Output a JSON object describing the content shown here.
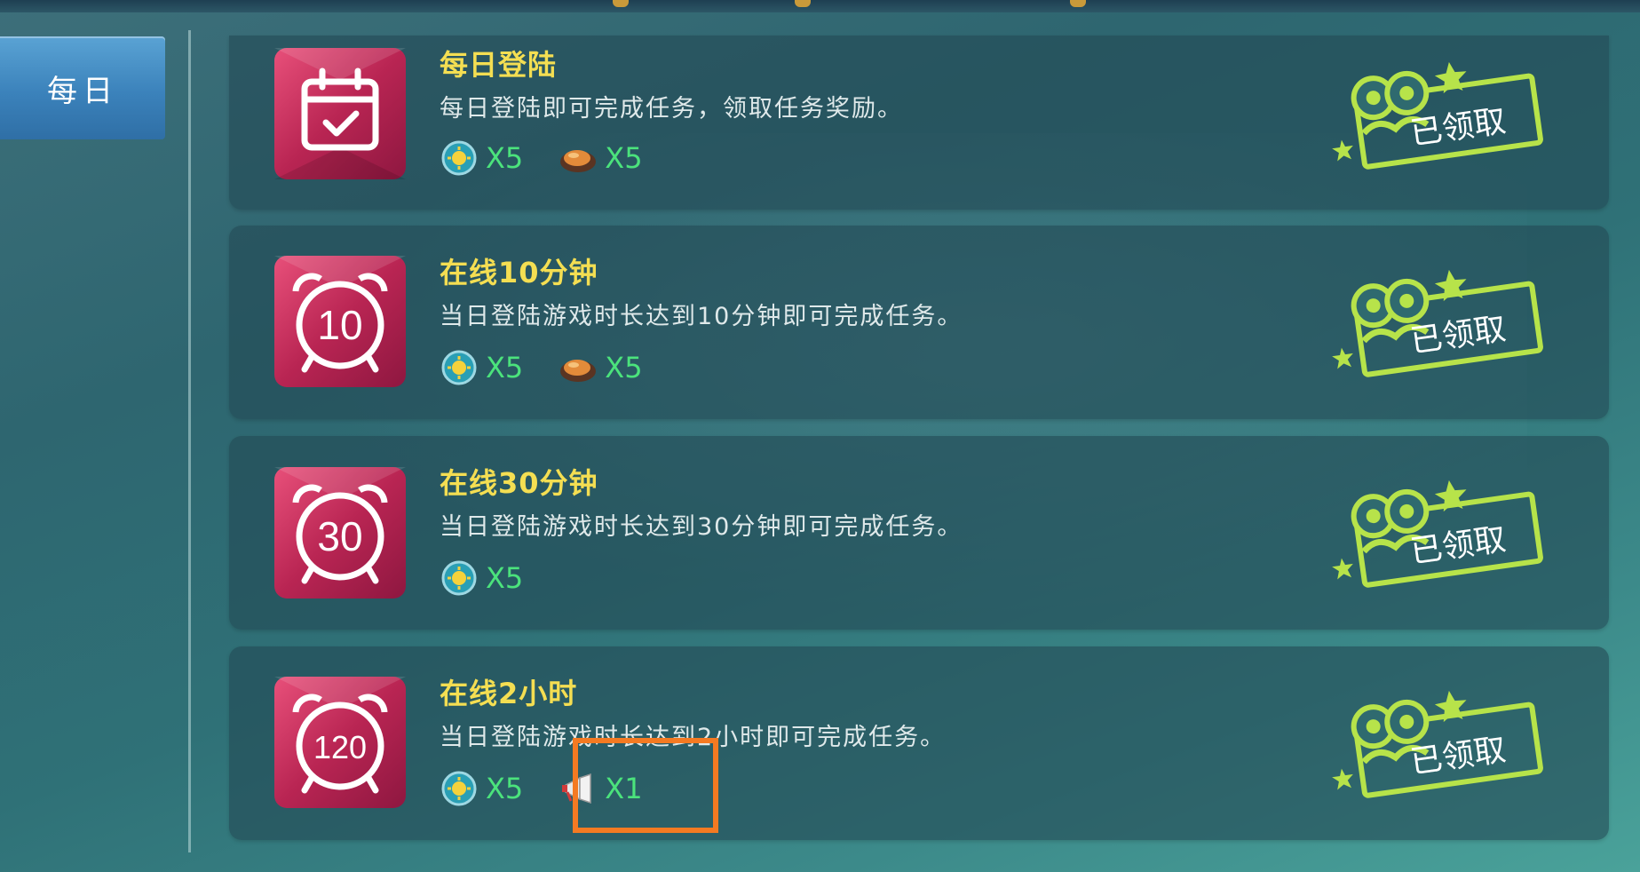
{
  "sidebar": {
    "tab_label": "每日"
  },
  "stamp_text": "已领取",
  "tasks": [
    {
      "icon": "calendar-check-icon",
      "title": "每日登陆",
      "desc": "每日登陆即可完成任务，领取任务奖励。",
      "rewards": [
        {
          "icon": "gear-coin-icon",
          "qty": "X5"
        },
        {
          "icon": "roast-food-icon",
          "qty": "X5"
        }
      ]
    },
    {
      "icon": "alarm-clock-icon",
      "icon_number": "10",
      "title": "在线10分钟",
      "desc": "当日登陆游戏时长达到10分钟即可完成任务。",
      "rewards": [
        {
          "icon": "gear-coin-icon",
          "qty": "X5"
        },
        {
          "icon": "roast-food-icon",
          "qty": "X5"
        }
      ]
    },
    {
      "icon": "alarm-clock-icon",
      "icon_number": "30",
      "title": "在线30分钟",
      "desc": "当日登陆游戏时长达到30分钟即可完成任务。",
      "rewards": [
        {
          "icon": "gear-coin-icon",
          "qty": "X5"
        }
      ]
    },
    {
      "icon": "alarm-clock-icon",
      "icon_number": "120",
      "title": "在线2小时",
      "desc": "当日登陆游戏时长达到2小时即可完成任务。",
      "rewards": [
        {
          "icon": "gear-coin-icon",
          "qty": "X5"
        },
        {
          "icon": "megaphone-icon",
          "qty": "X1"
        }
      ]
    }
  ],
  "colors": {
    "title": "#f4de52",
    "reward_qty": "#4be37c",
    "stamp_green": "#b7e34a",
    "highlight": "#f47a22",
    "tab_blue": "#3b82bb"
  }
}
